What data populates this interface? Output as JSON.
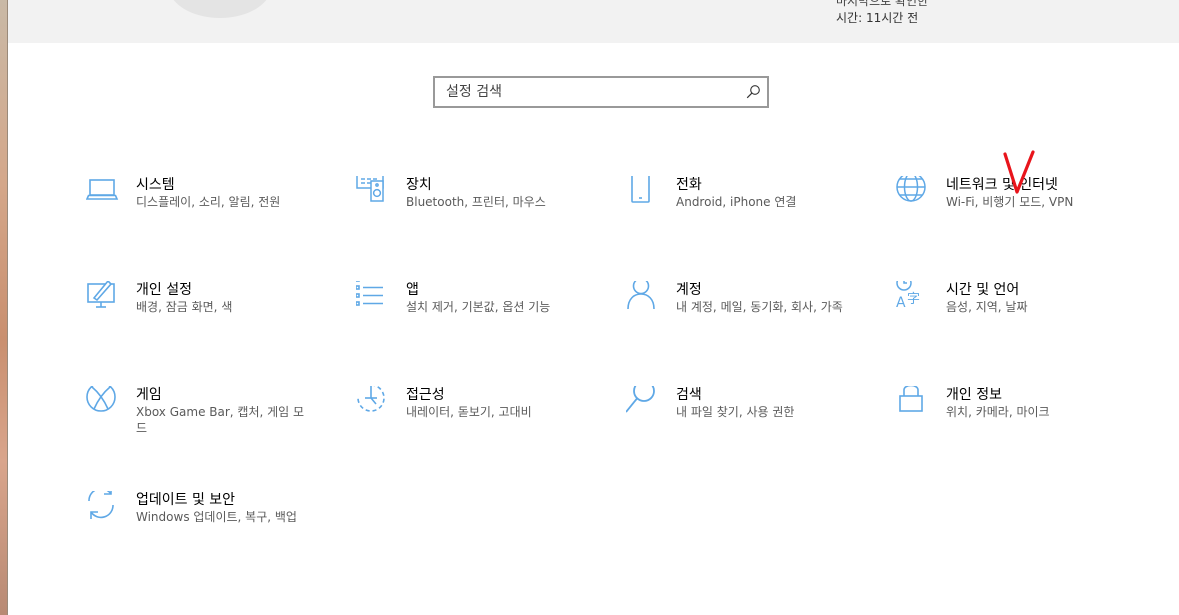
{
  "header": {
    "line1": "마지막으로 확인한",
    "line2": "시간: 11시간 전"
  },
  "search": {
    "placeholder": "설정 검색",
    "icon": "search-icon"
  },
  "categories": [
    {
      "id": "system",
      "title": "시스템",
      "subtitle": "디스플레이, 소리, 알림, 전원",
      "icon": "laptop-icon"
    },
    {
      "id": "devices",
      "title": "장치",
      "subtitle": "Bluetooth, 프린터, 마우스",
      "icon": "devices-icon"
    },
    {
      "id": "phone",
      "title": "전화",
      "subtitle": "Android, iPhone 연결",
      "icon": "phone-icon"
    },
    {
      "id": "network",
      "title": "네트워크 및 인터넷",
      "subtitle": "Wi-Fi, 비행기 모드, VPN",
      "icon": "globe-icon"
    },
    {
      "id": "personalization",
      "title": "개인 설정",
      "subtitle": "배경, 잠금 화면, 색",
      "icon": "personalization-icon"
    },
    {
      "id": "apps",
      "title": "앱",
      "subtitle": "설치 제거, 기본값, 옵션 기능",
      "icon": "apps-list-icon"
    },
    {
      "id": "accounts",
      "title": "계정",
      "subtitle": "내 계정, 메일, 동기화, 회사, 가족",
      "icon": "person-icon"
    },
    {
      "id": "time-language",
      "title": "시간 및 언어",
      "subtitle": "음성, 지역, 날짜",
      "icon": "time-language-icon"
    },
    {
      "id": "gaming",
      "title": "게임",
      "subtitle": "Xbox Game Bar, 캡처, 게임 모드",
      "icon": "xbox-icon"
    },
    {
      "id": "ease-of-access",
      "title": "접근성",
      "subtitle": "내레이터, 돋보기, 고대비",
      "icon": "ease-of-access-icon"
    },
    {
      "id": "search",
      "title": "검색",
      "subtitle": "내 파일 찾기, 사용 권한",
      "icon": "magnifier-icon"
    },
    {
      "id": "privacy",
      "title": "개인 정보",
      "subtitle": "위치, 카메라, 마이크",
      "icon": "lock-icon"
    },
    {
      "id": "update-security",
      "title": "업데이트 및 보안",
      "subtitle": "Windows 업데이트, 복구, 백업",
      "icon": "sync-icon"
    }
  ],
  "annotation": {
    "mark": "V",
    "color": "#e8141b"
  },
  "colors": {
    "accent": "#5fa8e6",
    "header_bg": "#f2f2f2",
    "subtitle_text": "#5a5a5a"
  }
}
